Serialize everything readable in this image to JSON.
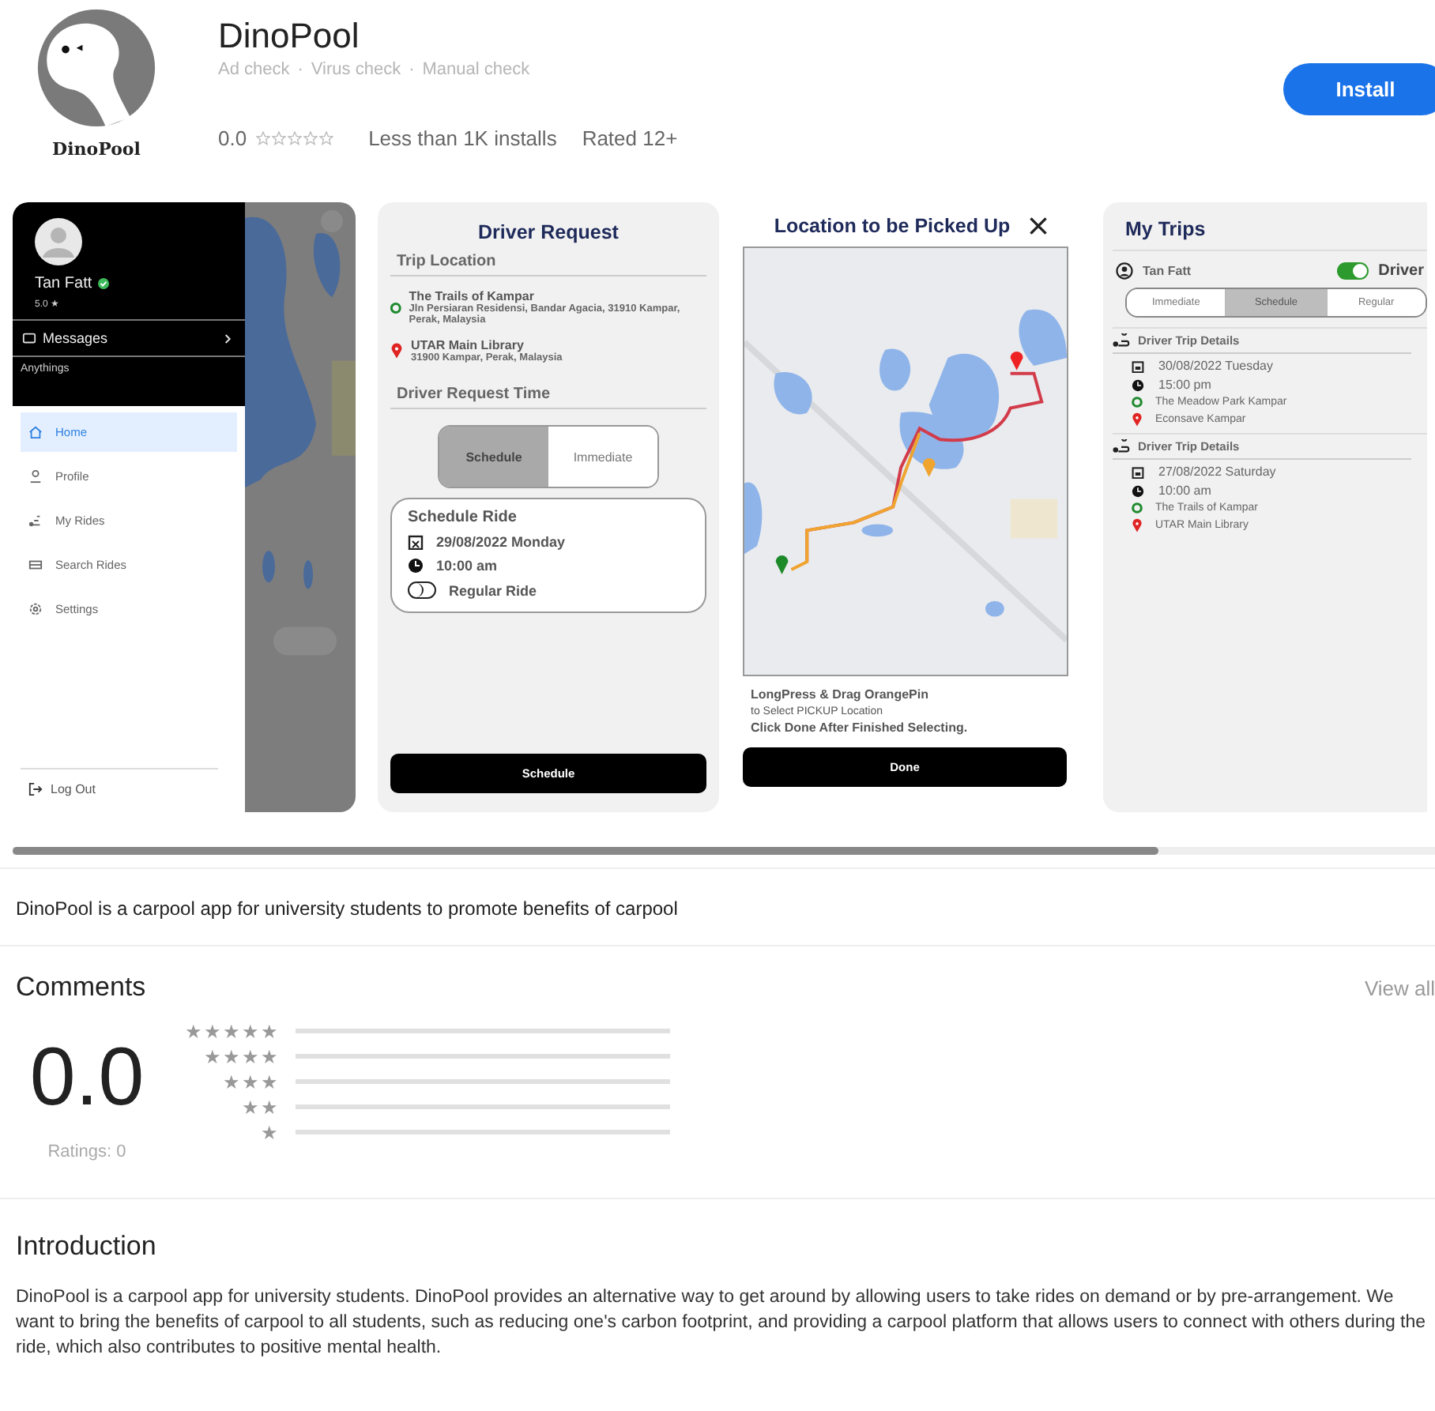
{
  "app": {
    "name": "DinoPool",
    "logo_text": "DinoPool",
    "checks": [
      "Ad check",
      "Virus check",
      "Manual check"
    ],
    "separator": "·",
    "rating": "0.0",
    "stars": 0,
    "installs": "Less than 1K installs",
    "content_rating": "Rated 12+",
    "install_button": "Install"
  },
  "screenshots": [
    {
      "kind": "drawer",
      "user": "Tan Fatt",
      "verified": true,
      "user_rating": "5.0 ★",
      "messages": "Messages",
      "section": "Anythings",
      "menu": [
        {
          "label": "Home",
          "selected": true
        },
        {
          "label": "Profile",
          "selected": false
        },
        {
          "label": "My Rides",
          "selected": false
        },
        {
          "label": "Search Rides",
          "selected": false
        },
        {
          "label": "Settings",
          "selected": false
        }
      ],
      "logout": "Log Out"
    },
    {
      "kind": "request",
      "title": "Driver Request",
      "trip_heading": "Trip Location",
      "origin": {
        "name": "The Trails of Kampar",
        "address": "Jln Persiaran Residensi, Bandar Agacia, 31910 Kampar, Perak, Malaysia"
      },
      "destination": {
        "name": "UTAR Main Library",
        "address": "31900 Kampar, Perak, Malaysia"
      },
      "time_heading": "Driver Request Time",
      "modes": [
        {
          "label": "Schedule",
          "selected": true
        },
        {
          "label": "Immediate",
          "selected": false
        }
      ],
      "schedule_title": "Schedule Ride",
      "date": "29/08/2022  Monday",
      "time": "10:00 am",
      "regular": {
        "label": "Regular Ride",
        "on": false
      },
      "button": "Schedule"
    },
    {
      "kind": "pickup",
      "title": "Location to be Picked Up",
      "hint_lines": [
        "LongPress & Drag OrangePin",
        "to Select PICKUP Location",
        "Click Done After Finished Selecting."
      ],
      "button": "Done"
    },
    {
      "kind": "trips",
      "title": "My Trips",
      "user": "Tan Fatt",
      "driver": {
        "label": "Driver",
        "on": true
      },
      "tabs": [
        {
          "label": "Immediate",
          "selected": false
        },
        {
          "label": "Schedule",
          "selected": true
        },
        {
          "label": "Regular",
          "selected": false
        }
      ],
      "trips": [
        {
          "heading": "Driver Trip Details",
          "date": "30/08/2022  Tuesday",
          "time": "15:00 pm",
          "from": "The Meadow Park Kampar",
          "to": "Econsave Kampar"
        },
        {
          "heading": "Driver Trip Details",
          "date": "27/08/2022  Saturday",
          "time": "10:00 am",
          "from": "The Trails of Kampar",
          "to": "UTAR Main Library"
        }
      ]
    }
  ],
  "description": "DinoPool is a carpool app for university students to promote benefits of carpool",
  "comments": {
    "title": "Comments",
    "view_all": "View all",
    "score": "0.0",
    "ratings_count": "Ratings: 0",
    "distribution": [
      {
        "label": "★★★★★",
        "level": 0
      },
      {
        "label": "★★★★",
        "level": 0
      },
      {
        "label": "★★★",
        "level": 0
      },
      {
        "label": "★★",
        "level": 0
      },
      {
        "label": "★",
        "level": 0
      }
    ]
  },
  "introduction": {
    "title": "Introduction",
    "text": "DinoPool is a carpool app for university students. DinoPool provides an alternative way to get around by allowing users to take rides on demand or by pre-arrangement. We want to bring the benefits of carpool to all students, such as reducing one's carbon footprint, and providing a carpool platform that allows users to connect with others during the ride, which also contributes to positive mental health."
  }
}
